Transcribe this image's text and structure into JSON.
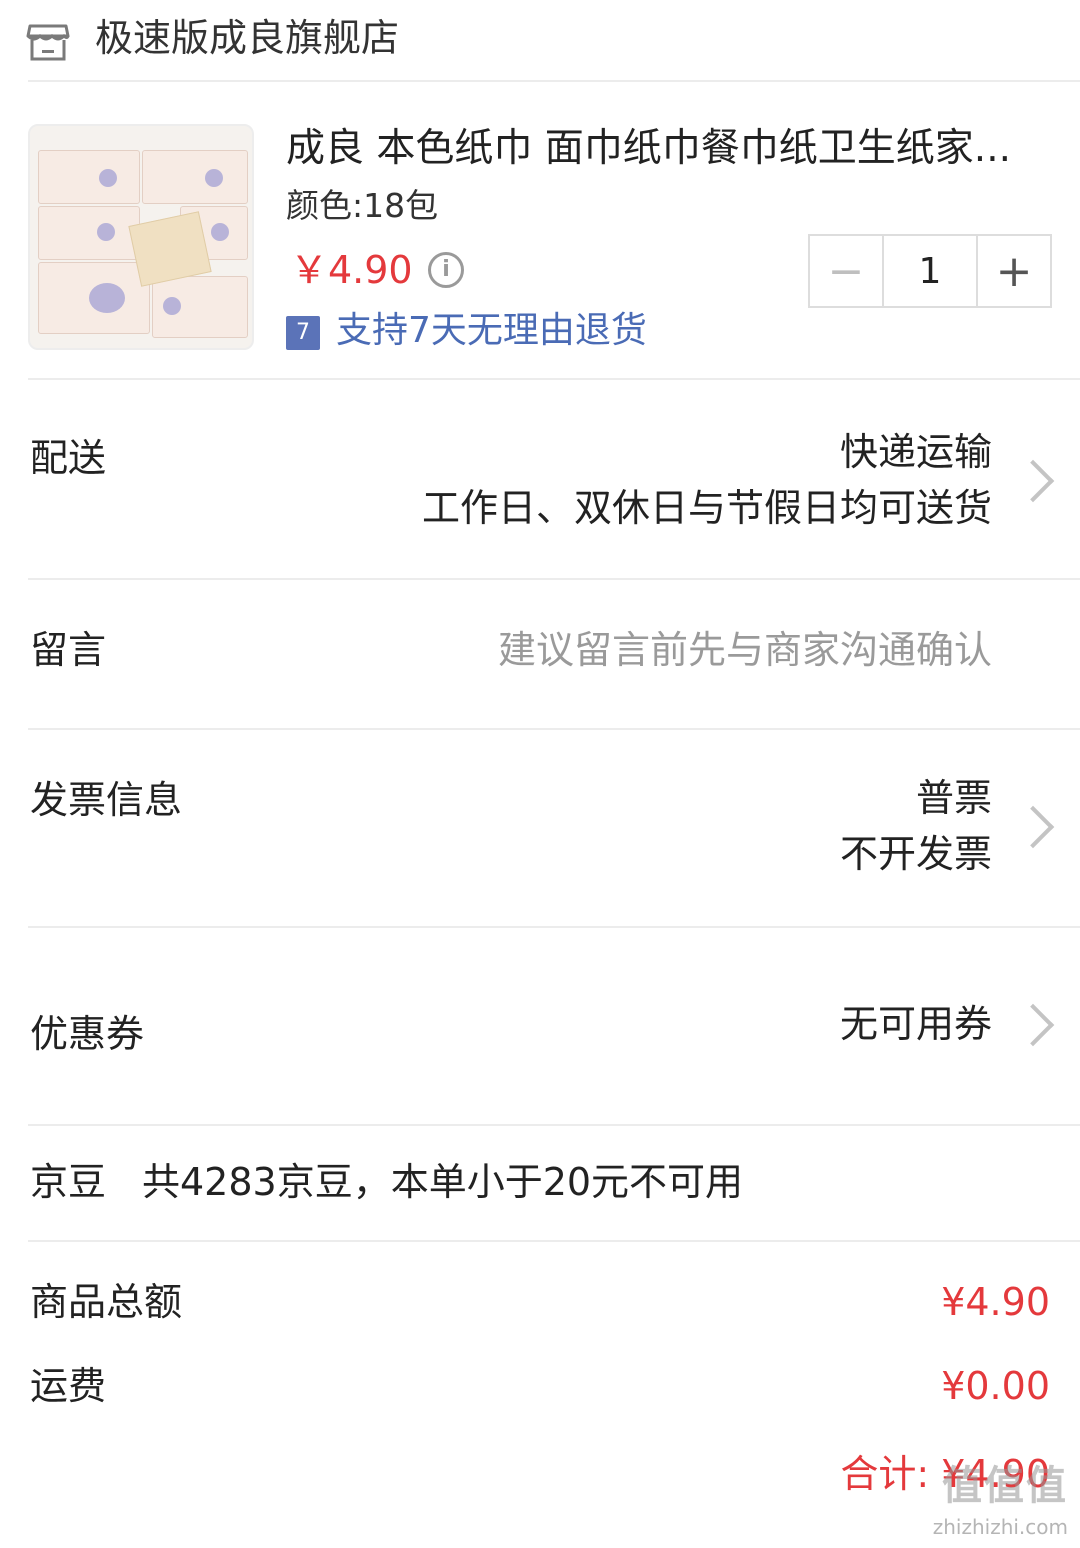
{
  "store": {
    "name": "极速版成良旗舰店",
    "icon": "store-icon"
  },
  "product": {
    "title": "成良 本色纸巾 面巾纸巾餐巾纸卫生纸家...",
    "spec": "颜色:18包",
    "price": "￥4.90",
    "quantity": "1",
    "return_badge": "7",
    "return_policy": "支持7天无理由退货",
    "info_icon": "info-icon"
  },
  "delivery": {
    "label": "配送",
    "method": "快递运输",
    "schedule": "工作日、双休日与节假日均可送货"
  },
  "message": {
    "label": "留言",
    "placeholder": "建议留言前先与商家沟通确认"
  },
  "invoice": {
    "label": "发票信息",
    "type": "普票",
    "status": "不开发票"
  },
  "coupon": {
    "label": "优惠券",
    "value": "无可用券"
  },
  "jingdou": {
    "label": "京豆",
    "info": "共4283京豆，本单小于20元不可用"
  },
  "summary": {
    "goods_label": "商品总额",
    "goods_value": "¥4.90",
    "shipping_label": "运费",
    "shipping_value": "¥0.00",
    "total": "合计: ¥4.90"
  },
  "watermark": {
    "logo": "值值值",
    "site": "zhizhizhi.com"
  },
  "colors": {
    "price_red": "#e4393c",
    "link_blue": "#4a6bb5",
    "divider": "#ececec"
  }
}
